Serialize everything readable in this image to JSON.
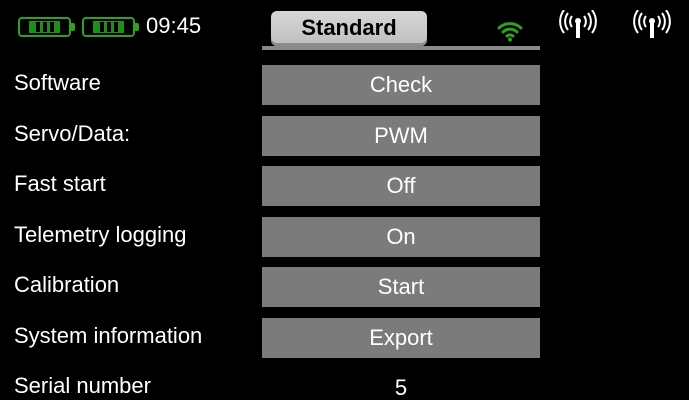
{
  "status_bar": {
    "time": "09:45",
    "profile_tab": "Standard",
    "icons": [
      "battery-icon",
      "battery-icon",
      "wifi-icon",
      "antenna-icon",
      "antenna-icon"
    ],
    "colors": {
      "battery": "#2ea21f",
      "wifi": "#2ea21f",
      "tab": "#c8c8c8"
    }
  },
  "settings": {
    "software": {
      "label": "Software",
      "value": "Check"
    },
    "servo_data": {
      "label": "Servo/Data:",
      "value": "PWM"
    },
    "fast_start": {
      "label": "Fast start",
      "value": "Off"
    },
    "telemetry_logging": {
      "label": "Telemetry logging",
      "value": "On"
    },
    "calibration": {
      "label": "Calibration",
      "value": "Start"
    },
    "system_information": {
      "label": "System information",
      "value": "Export"
    },
    "serial_number": {
      "label": "Serial number",
      "value": "5"
    }
  },
  "colors": {
    "background": "#000000",
    "button": "#7b7b7b",
    "text": "#ffffff"
  }
}
